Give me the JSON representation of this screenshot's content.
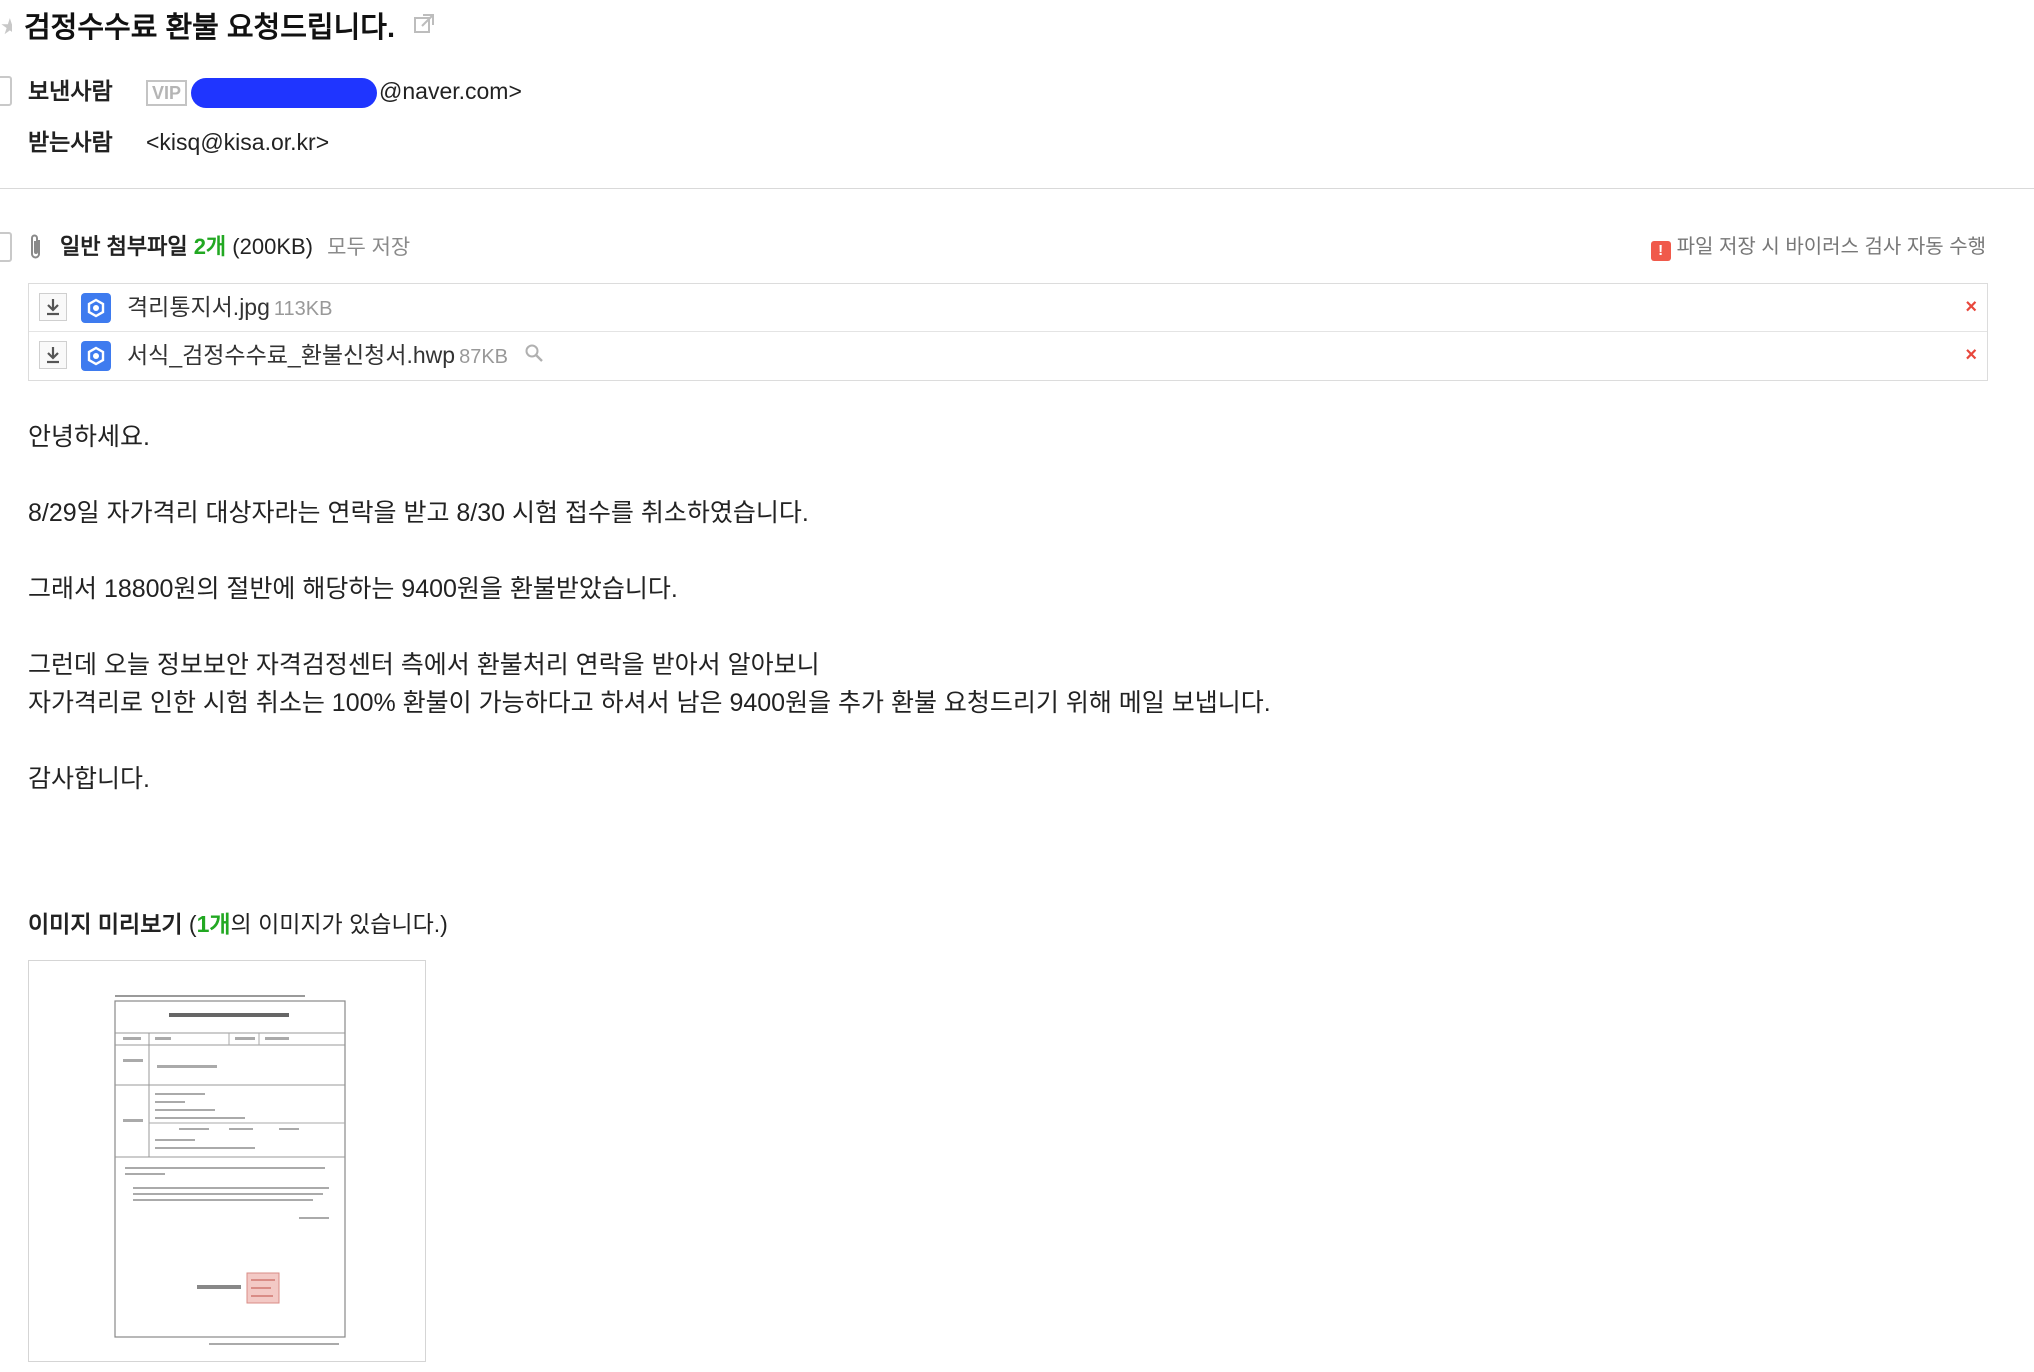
{
  "mail": {
    "subject": "검정수수료 환불 요청드립니다.",
    "star_icon": "star-icon",
    "popout_icon": "external-link-icon",
    "from_label": "보낸사람",
    "vip_badge": "VIP",
    "from_domain": "@naver.com>",
    "to_label": "받는사람",
    "to_value": "<kisq@kisa.or.kr>"
  },
  "attachments": {
    "title": "일반 첨부파일",
    "count": "2개",
    "total_size": "(200KB)",
    "save_all": "모두 저장",
    "virus_notice": "파일 저장 시 바이러스 검사 자동 수행",
    "warn_glyph": "!",
    "files": [
      {
        "name": "격리통지서.jpg",
        "size": "113KB",
        "delete": "×"
      },
      {
        "name": "서식_검정수수료_환불신청서.hwp",
        "size": "87KB",
        "delete": "×"
      }
    ]
  },
  "body": {
    "lines": [
      "안녕하세요.",
      "8/29일 자가격리 대상자라는 연락을 받고 8/30 시험 접수를 취소하였습니다.",
      "그래서 18800원의 절반에 해당하는 9400원을 환불받았습니다.",
      "그런데 오늘 정보보안 자격검정센터 측에서 환불처리 연락을 받아서 알아보니",
      "자가격리로 인한 시험 취소는 100% 환불이 가능하다고 하셔서 남은 9400원을 추가 환불 요청드리기 위해 메일 보냅니다.",
      "감사합니다."
    ]
  },
  "preview": {
    "title": "이미지 미리보기",
    "paren_open": " (",
    "count": "1개",
    "suffix": "의 이미지가 있습니다.)"
  },
  "colors": {
    "accent_green": "#22a822",
    "delete_red": "#e8473c",
    "redaction_blue": "#1f35ff",
    "file_icon_blue": "#3e7bef"
  }
}
